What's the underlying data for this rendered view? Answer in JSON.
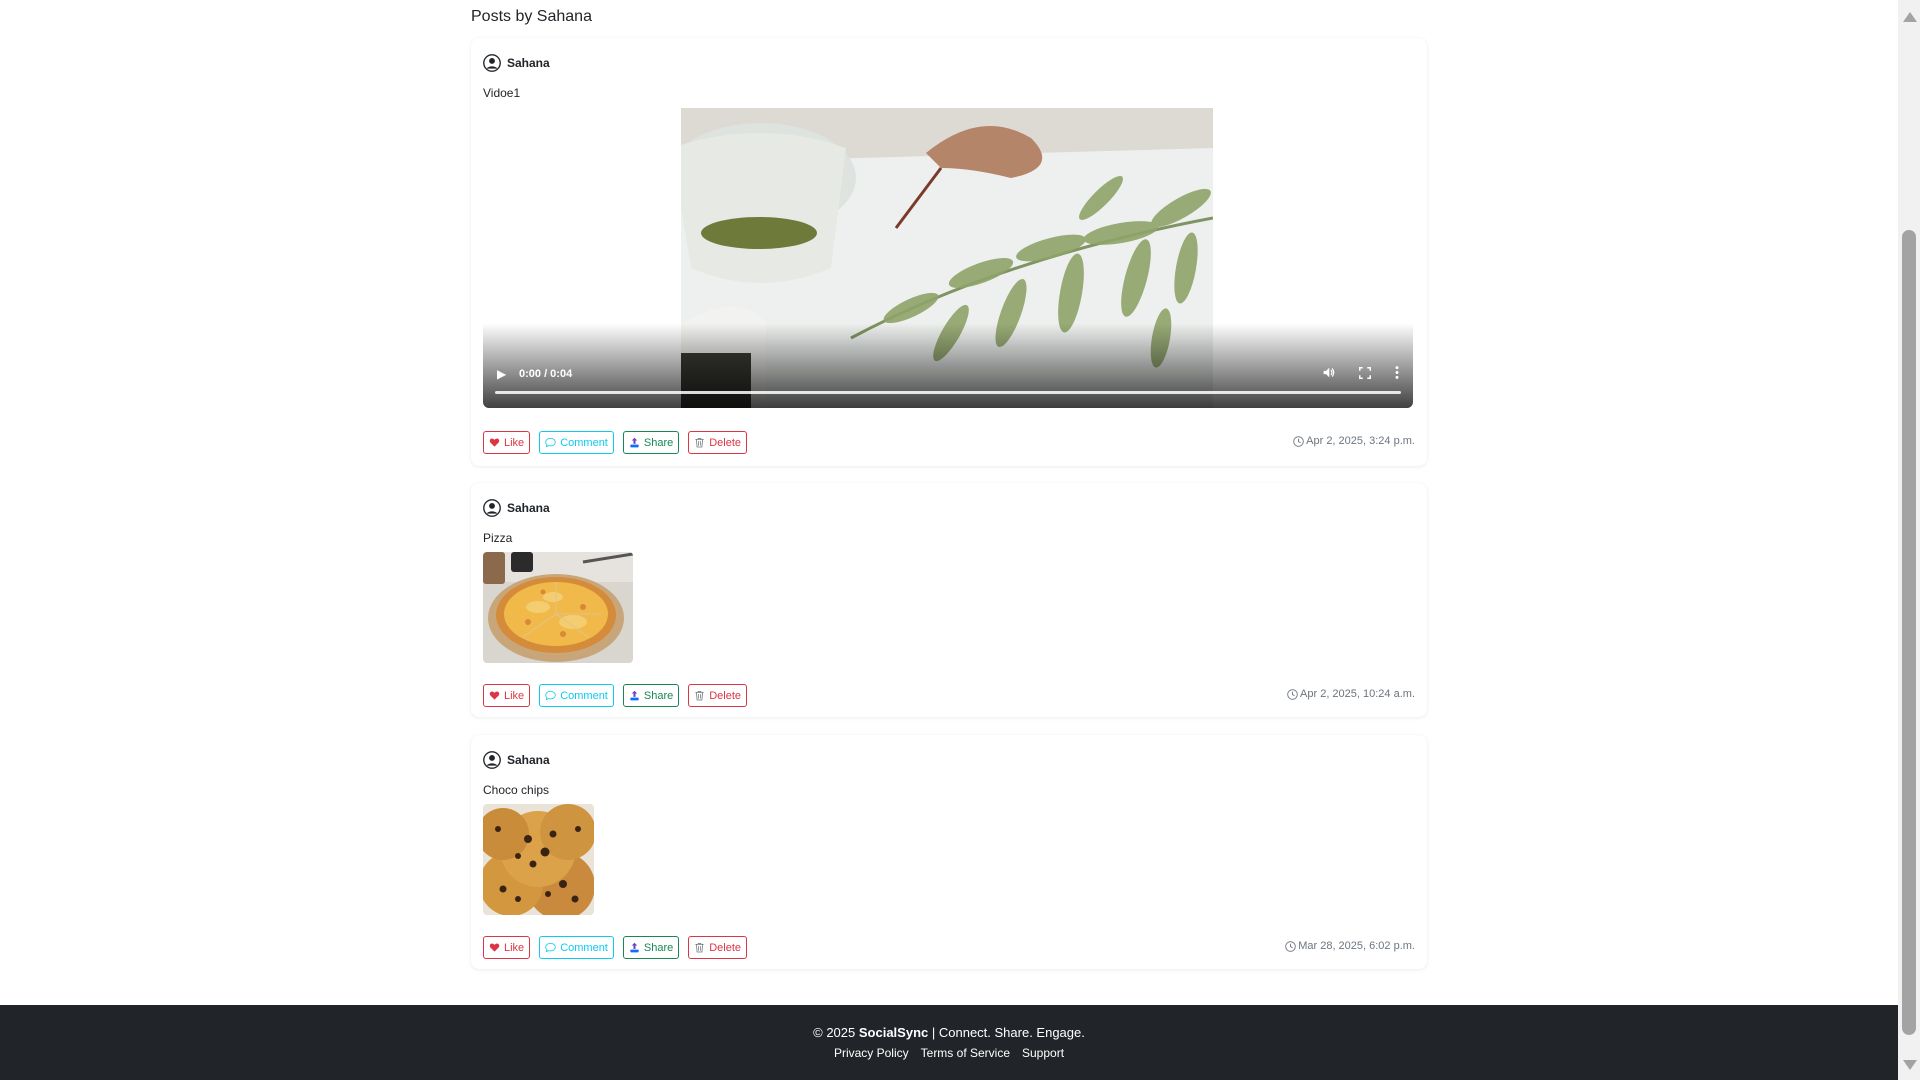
{
  "page": {
    "title": "Posts by Sahana"
  },
  "colors": {
    "like": "#dc3545",
    "comment": "#0dcaf0",
    "share": "#198754",
    "delete": "#dc3545",
    "footer_bg": "#212529"
  },
  "actions": {
    "like": "Like",
    "comment": "Comment",
    "share": "Share",
    "delete": "Delete"
  },
  "posts": [
    {
      "author": "Sahana",
      "caption": "Vidoe1",
      "media": "video",
      "media_description": "hand painting green leaves with watercolor",
      "video_time": "0:00 / 0:04",
      "timestamp": "Apr 2, 2025, 3:24 p.m."
    },
    {
      "author": "Sahana",
      "caption": "Pizza",
      "media": "image",
      "media_description": "cheese pizza on board",
      "timestamp": "Apr 2, 2025, 10:24 a.m."
    },
    {
      "author": "Sahana",
      "caption": "Choco chips",
      "media": "image",
      "media_description": "stack of chocolate chip cookies",
      "timestamp": "Mar 28, 2025, 6:02 p.m."
    }
  ],
  "footer": {
    "copyright_prefix": "© 2025",
    "brand": "SocialSync",
    "tagline": "| Connect. Share. Engage.",
    "links": [
      "Privacy Policy",
      "Terms of Service",
      "Support"
    ]
  }
}
